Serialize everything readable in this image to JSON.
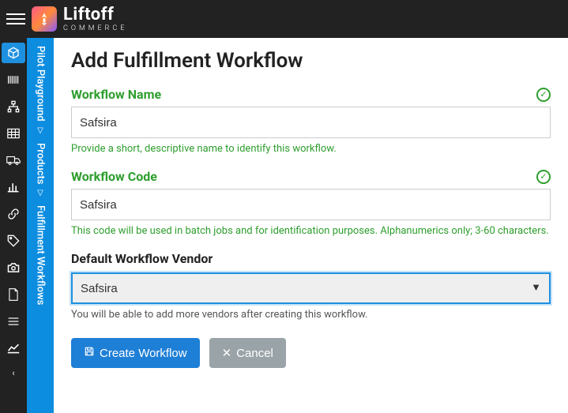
{
  "brand": {
    "main": "Liftoff",
    "sub": "COMMERCE"
  },
  "blueRail": {
    "section1": "Pilot Playground",
    "section2": "Products",
    "section3": "Fulfillment Workflows"
  },
  "page": {
    "title": "Add Fulfillment Workflow",
    "fields": {
      "name": {
        "label": "Workflow Name",
        "value": "Safsira",
        "help": "Provide a short, descriptive name to identify this workflow."
      },
      "code": {
        "label": "Workflow Code",
        "value": "Safsira",
        "help": "This code will be used in batch jobs and for identification purposes. Alphanumerics only; 3-60 characters."
      },
      "vendor": {
        "label": "Default Workflow Vendor",
        "value": "Safsira",
        "help": "You will be able to add more vendors after creating this workflow."
      }
    },
    "buttons": {
      "create": "Create Workflow",
      "cancel": "Cancel"
    }
  }
}
